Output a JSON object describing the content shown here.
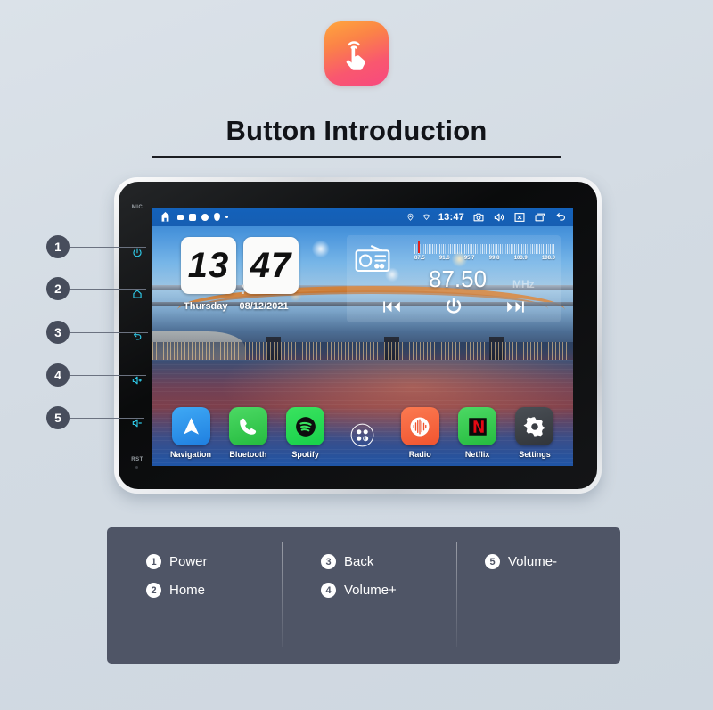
{
  "logo": {
    "icon": "tap-hand-icon",
    "gradient_start": "#ffa63d",
    "gradient_end": "#f8497f"
  },
  "header": {
    "title": "Button Introduction"
  },
  "device": {
    "bezel": {
      "mic_label": "MIC",
      "rst_label": "RST",
      "keys": [
        {
          "n": "1",
          "icon": "power-icon",
          "name": "Power"
        },
        {
          "n": "2",
          "icon": "home-icon",
          "name": "Home"
        },
        {
          "n": "3",
          "icon": "back-icon",
          "name": "Back"
        },
        {
          "n": "4",
          "icon": "volume-up-icon",
          "name": "Volume+"
        },
        {
          "n": "5",
          "icon": "volume-down-icon",
          "name": "Volume-"
        }
      ]
    },
    "statusbar": {
      "home_icon": "home-icon",
      "left_icons": [
        "image-icon",
        "square-icon",
        "circle-icon",
        "pin-icon",
        "dot-icon"
      ],
      "location_icon": "location-icon",
      "wifi_icon": "wifi-icon",
      "time": "13:47",
      "right_icons": [
        "camera-icon",
        "volume-icon",
        "close-box-icon",
        "recent-apps-icon",
        "back-arrow-icon"
      ]
    },
    "clock_widget": {
      "hours": "13",
      "minutes": "47",
      "separator": ":",
      "weekday": "Thursday",
      "date": "08/12/2021"
    },
    "radio_widget": {
      "icon": "radio-icon",
      "dial_labels": [
        "87.5",
        "91.6",
        "95.7",
        "99.8",
        "103.9",
        "108.0"
      ],
      "frequency": "87.50",
      "unit": "MHz",
      "controls": [
        "prev-icon",
        "power-icon",
        "next-icon"
      ]
    },
    "apps": [
      {
        "label": "Navigation",
        "icon": "navigation-icon",
        "class": "ic-nav"
      },
      {
        "label": "Bluetooth",
        "icon": "phone-icon",
        "class": "ic-bt"
      },
      {
        "label": "Spotify",
        "icon": "spotify-icon",
        "class": "ic-spotify"
      },
      {
        "label": "",
        "icon": "app-drawer-icon",
        "class": "ic-drawer"
      },
      {
        "label": "Radio",
        "icon": "radio-wave-icon",
        "class": "ic-radio"
      },
      {
        "label": "Netflix",
        "icon": "netflix-icon",
        "class": "ic-netflix"
      },
      {
        "label": "Settings",
        "icon": "gear-icon",
        "class": "ic-settings"
      }
    ]
  },
  "callouts": [
    {
      "number": "1"
    },
    {
      "number": "2"
    },
    {
      "number": "3"
    },
    {
      "number": "4"
    },
    {
      "number": "5"
    }
  ],
  "legend": {
    "columns": [
      {
        "items": [
          {
            "number": "1",
            "label": "Power"
          },
          {
            "number": "2",
            "label": "Home"
          }
        ]
      },
      {
        "items": [
          {
            "number": "3",
            "label": "Back"
          },
          {
            "number": "4",
            "label": "Volume+"
          }
        ]
      },
      {
        "items": [
          {
            "number": "5",
            "label": "Volume-"
          }
        ]
      }
    ],
    "background": "#4f5566"
  },
  "colors": {
    "page_background": "#d5dce4",
    "accent_cyan": "#2ec8e6",
    "statusbar_blue": "#1260ba",
    "callout_badge": "#474d5c"
  }
}
